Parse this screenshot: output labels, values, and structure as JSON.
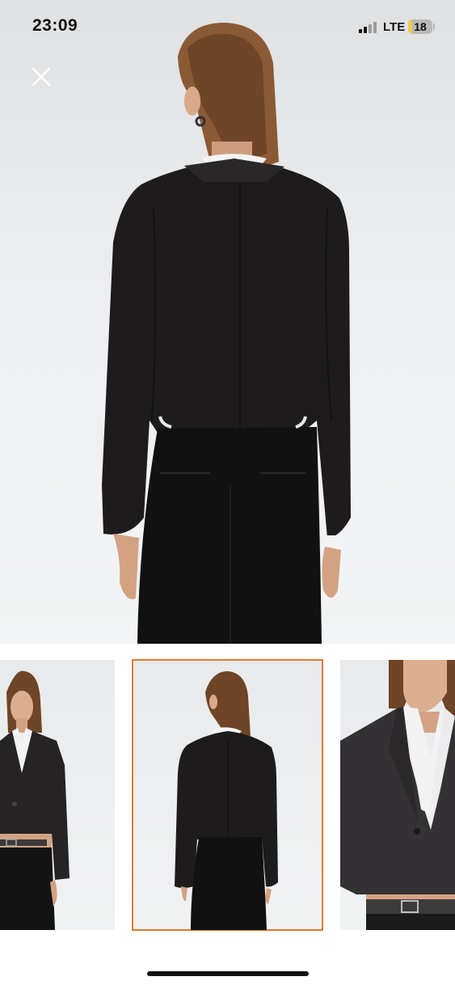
{
  "status_bar": {
    "time": "23:09",
    "network": "LTE",
    "battery_level": "18",
    "battery_color": "#f2c94c"
  },
  "viewer": {
    "close_icon": "close-icon",
    "main_image": "product-photo-back-view",
    "selected_thumbnail_index": 1,
    "accent_color": "#e37b2c"
  },
  "thumbnails": [
    {
      "name": "front-view"
    },
    {
      "name": "back-view"
    },
    {
      "name": "detail-view"
    }
  ]
}
